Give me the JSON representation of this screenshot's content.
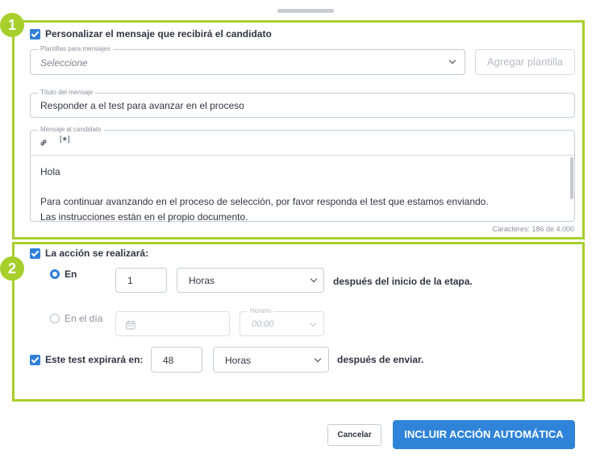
{
  "section1": {
    "number": "1",
    "personalize_label": "Personalizar el mensaje que recibirá el candidato",
    "templates": {
      "legend": "Plantillas para mensajes",
      "placeholder": "Seleccione"
    },
    "add_template_button": "Agregar plantilla",
    "title_field": {
      "legend": "Título del mensaje",
      "value": "Responder a el test para avanzar en el proceso"
    },
    "message_field": {
      "legend": "Mensaje al candidato",
      "variable_tool": "[∗]",
      "lines": [
        "Hola",
        "",
        "Para continuar avanzando en el proceso de selección, por favor responda el test que estamos enviando.",
        "Las instrucciones están en el propio documento."
      ]
    },
    "char_count": "Caracteres: 186 de 4.000"
  },
  "section2": {
    "number": "2",
    "action_label": "La acción se realizará:",
    "option_in": {
      "label": "En",
      "value": "1",
      "unit": "Horas",
      "suffix": "después del inicio de la etapa."
    },
    "option_on_day": {
      "label": "En el día",
      "time_legend": "Horario",
      "time_placeholder": "00:00"
    },
    "expires": {
      "label": "Este test expirará en:",
      "value": "48",
      "unit": "Horas",
      "suffix": "después de enviar."
    }
  },
  "footer": {
    "cancel_button": "Cancelar",
    "primary_button": "INCLUIR ACCIÓN AUTOMÁTICA"
  },
  "colors": {
    "highlight": "#a6cf2c",
    "accent": "#2f84d9"
  },
  "icons": [
    "link-icon",
    "calendar-icon",
    "chevron-down-icon",
    "check-icon"
  ]
}
